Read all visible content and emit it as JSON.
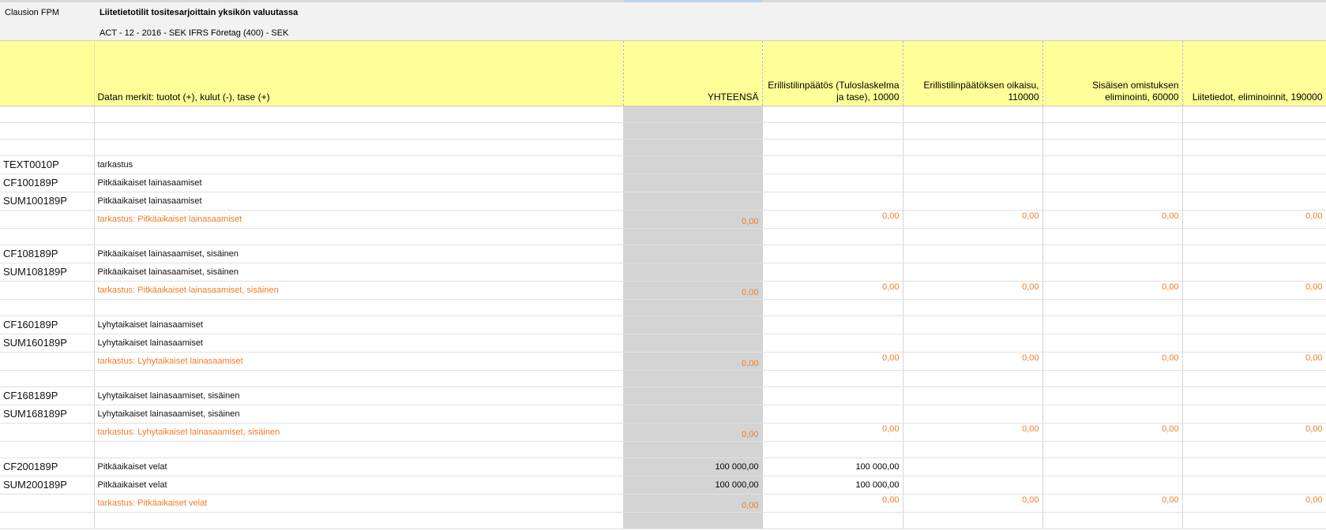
{
  "app_label": "Clausion FPM",
  "report": {
    "title": "Liitetietotilit tositesarjoittain yksikön valuutassa",
    "subtitle": "ACT - 12 - 2016 - SEK IFRS Företag (400) - SEK"
  },
  "columns": {
    "description": "Datan merkit: tuotot (+), kulut (-), tase (+)",
    "total": "YHTEENSÄ",
    "col1": "Erillistilinpäätös (Tuloslaskelma ja tase), 10000",
    "col2": "Erillistilinpäätöksen oikaisu, 110000",
    "col3": "Sisäisen omistuksen eliminointi, 60000",
    "col4": "Liitetiedot, eliminoinnit, 190000"
  },
  "rows": [
    {
      "type": "blank"
    },
    {
      "type": "blank"
    },
    {
      "type": "blank"
    },
    {
      "type": "data",
      "code": "TEXT0010P",
      "desc": "tarkastus",
      "total": "",
      "v1": "",
      "v2": "",
      "v3": "",
      "v4": ""
    },
    {
      "type": "data",
      "code": "CF100189P",
      "desc": "Pitkäaikaiset lainasaamiset",
      "total": "",
      "v1": "",
      "v2": "",
      "v3": "",
      "v4": ""
    },
    {
      "type": "data",
      "code": "SUM100189P",
      "desc": "Pitkäaikaiset lainasaamiset",
      "total": "",
      "v1": "",
      "v2": "",
      "v3": "",
      "v4": ""
    },
    {
      "type": "check",
      "code": "",
      "desc": "tarkastus: Pitkäaikaiset lainasaamiset",
      "total": "0,00",
      "v1": "0,00",
      "v2": "0,00",
      "v3": "0,00",
      "v4": "0,00"
    },
    {
      "type": "blank"
    },
    {
      "type": "data",
      "code": "CF108189P",
      "desc": "Pitkäaikaiset lainasaamiset, sisäinen",
      "total": "",
      "v1": "",
      "v2": "",
      "v3": "",
      "v4": ""
    },
    {
      "type": "data",
      "code": "SUM108189P",
      "desc": "Pitkäaikaiset lainasaamiset, sisäinen",
      "total": "",
      "v1": "",
      "v2": "",
      "v3": "",
      "v4": ""
    },
    {
      "type": "check",
      "code": "",
      "desc": "tarkastus: Pitkäaikaiset lainasaamiset, sisäinen",
      "total": "0,00",
      "v1": "0,00",
      "v2": "0,00",
      "v3": "0,00",
      "v4": "0,00"
    },
    {
      "type": "blank"
    },
    {
      "type": "data",
      "code": "CF160189P",
      "desc": "Lyhytaikaiset lainasaamiset",
      "total": "",
      "v1": "",
      "v2": "",
      "v3": "",
      "v4": ""
    },
    {
      "type": "data",
      "code": "SUM160189P",
      "desc": "Lyhytaikaiset lainasaamiset",
      "total": "",
      "v1": "",
      "v2": "",
      "v3": "",
      "v4": ""
    },
    {
      "type": "check",
      "code": "",
      "desc": "tarkastus: Lyhytaikaiset lainasaamiset",
      "total": "0,00",
      "v1": "0,00",
      "v2": "0,00",
      "v3": "0,00",
      "v4": "0,00"
    },
    {
      "type": "blank"
    },
    {
      "type": "data",
      "code": "CF168189P",
      "desc": "Lyhytaikaiset lainasaamiset, sisäinen",
      "total": "",
      "v1": "",
      "v2": "",
      "v3": "",
      "v4": ""
    },
    {
      "type": "data",
      "code": "SUM168189P",
      "desc": "Lyhytaikaiset lainasaamiset, sisäinen",
      "total": "",
      "v1": "",
      "v2": "",
      "v3": "",
      "v4": ""
    },
    {
      "type": "check",
      "code": "",
      "desc": "tarkastus: Lyhytaikaiset lainasaamiset, sisäinen",
      "total": "0,00",
      "v1": "0,00",
      "v2": "0,00",
      "v3": "0,00",
      "v4": "0,00"
    },
    {
      "type": "blank"
    },
    {
      "type": "data",
      "code": "CF200189P",
      "desc": "Pitkäaikaiset velat",
      "total": "100 000,00",
      "v1": "100 000,00",
      "v2": "",
      "v3": "",
      "v4": ""
    },
    {
      "type": "data",
      "code": "SUM200189P",
      "desc": "Pitkäaikaiset velat",
      "total": "100 000,00",
      "v1": "100 000,00",
      "v2": "",
      "v3": "",
      "v4": ""
    },
    {
      "type": "check",
      "code": "",
      "desc": "tarkastus: Pitkäaikaiset velat",
      "total": "0,00",
      "v1": "0,00",
      "v2": "0,00",
      "v3": "0,00",
      "v4": "0,00"
    },
    {
      "type": "blank"
    }
  ]
}
